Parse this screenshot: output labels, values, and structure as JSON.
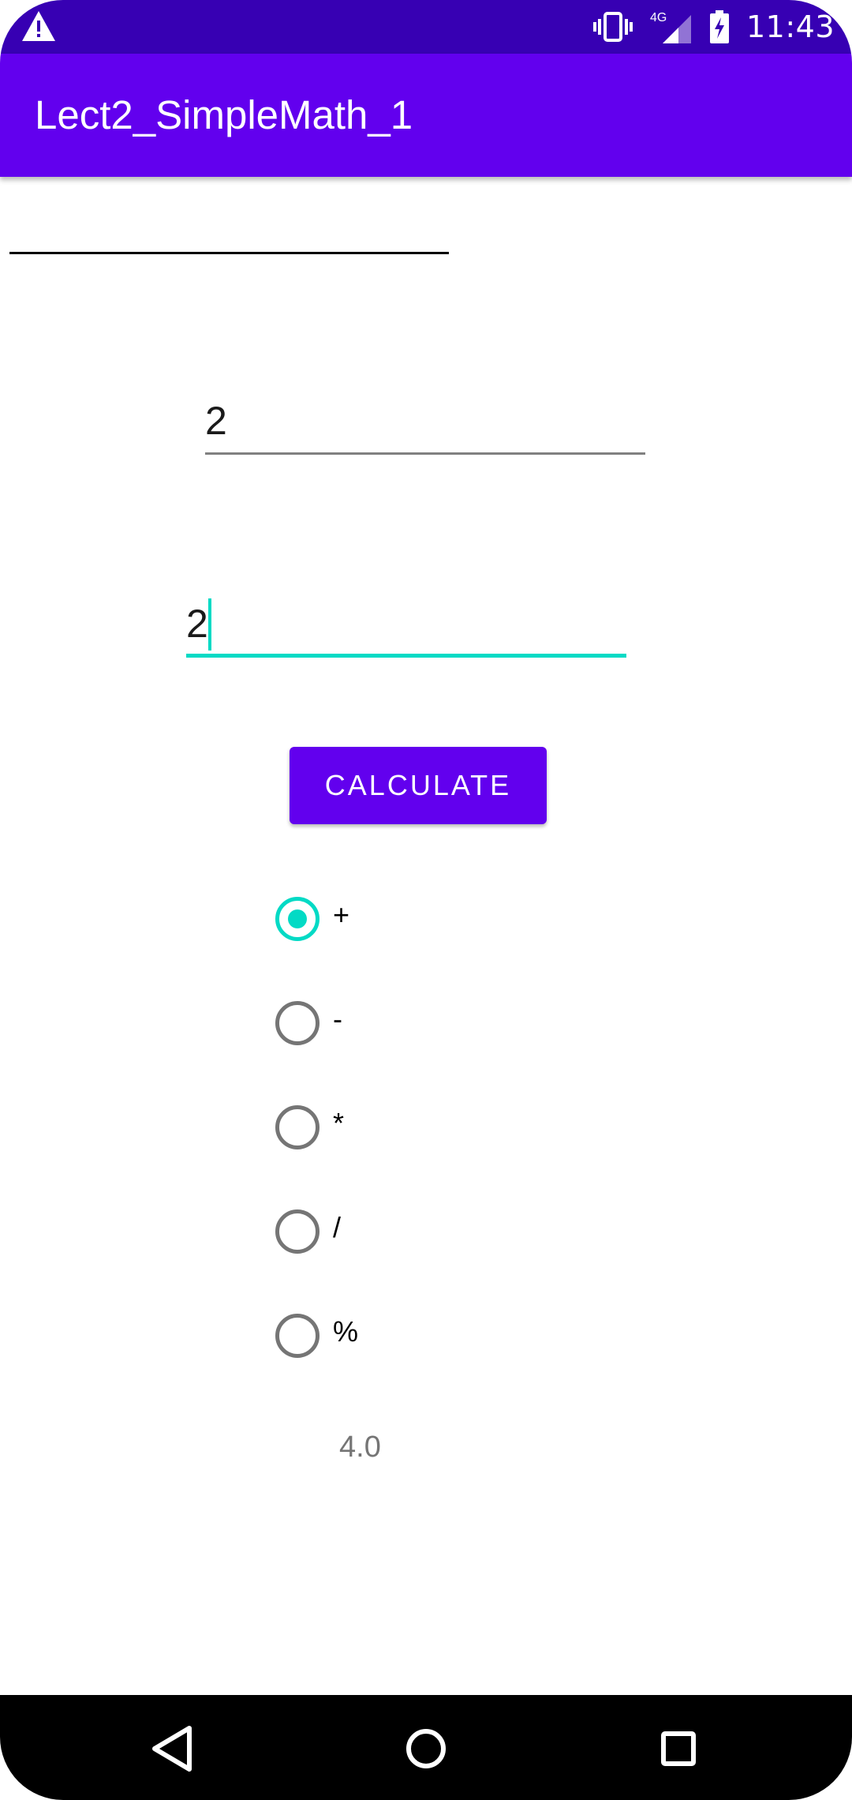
{
  "status_bar": {
    "time": "11:43",
    "network": "4G",
    "icons": [
      "alert-icon",
      "vibrate-icon",
      "signal-icon",
      "battery-charging-icon"
    ]
  },
  "app_bar": {
    "title": "Lect2_SimpleMath_1"
  },
  "form": {
    "first_number": {
      "value": "2"
    },
    "second_number": {
      "value": "2"
    },
    "calculate_label": "CALCULATE"
  },
  "operations": [
    {
      "label": "+",
      "checked": true
    },
    {
      "label": "-",
      "checked": false
    },
    {
      "label": "*",
      "checked": false
    },
    {
      "label": "/",
      "checked": false
    },
    {
      "label": "%",
      "checked": false
    }
  ],
  "result": "4.0",
  "nav": {
    "icons": [
      "back-icon",
      "home-icon",
      "recents-icon"
    ]
  },
  "colors": {
    "status_bar": "#3700B3",
    "primary": "#6200EE",
    "accent": "#03DAC5",
    "unchecked": "#757575"
  }
}
